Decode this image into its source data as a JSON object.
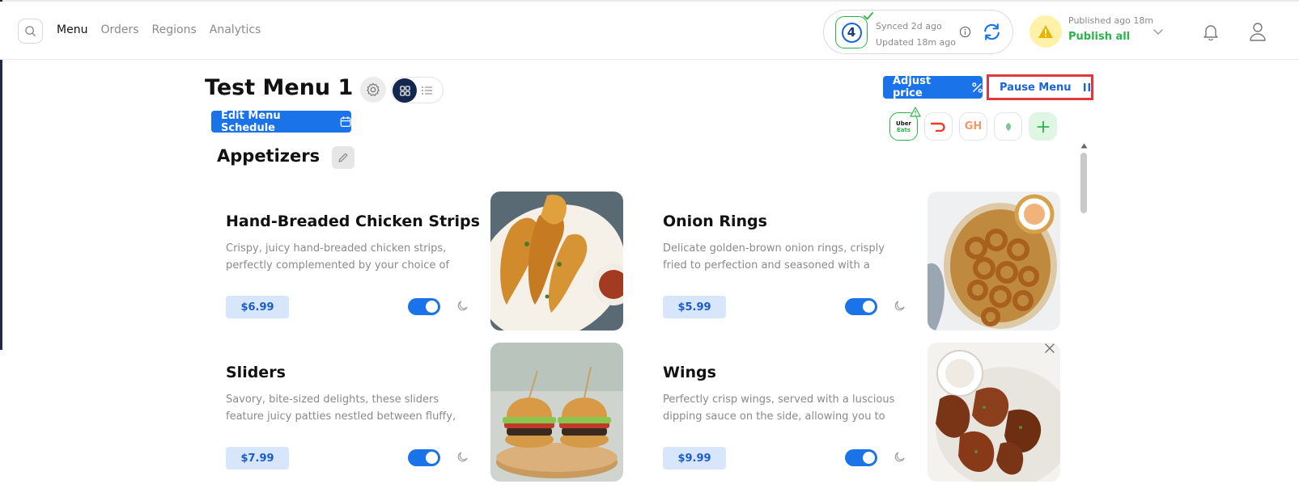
{
  "header": {
    "nav": [
      {
        "label": "Menu",
        "active": true
      },
      {
        "label": "Orders",
        "active": false
      },
      {
        "label": "Regions",
        "active": false
      },
      {
        "label": "Analytics",
        "active": false
      }
    ],
    "sync": {
      "badge_number": "4",
      "synced": "Synced 2d ago",
      "updated": "Updated 18m ago"
    },
    "publish": {
      "published": "Published ago 18m",
      "action": "Publish all"
    },
    "icons": [
      "search-icon",
      "info-icon",
      "refresh-icon",
      "warning-icon",
      "chevron-down-icon",
      "bell-icon",
      "user-icon"
    ]
  },
  "menu": {
    "title": "Test Menu 1",
    "edit_schedule_label": "Edit Menu Schedule",
    "adjust_price_label": "Adjust price",
    "pause_label": "Pause Menu",
    "platforms": [
      "Uber Eats",
      "DoorDash",
      "GH",
      "Postmates"
    ],
    "uber_logo_top": "Uber",
    "uber_logo_bottom": "Eats",
    "gh_logo": "GH"
  },
  "section": {
    "title": "Appetizers"
  },
  "items": [
    {
      "name": "Hand-Breaded Chicken Strips",
      "description": "Crispy, juicy hand-breaded chicken strips, perfectly complemented by your choice of",
      "price": "$6.99",
      "enabled": true
    },
    {
      "name": "Onion Rings",
      "description": "Delicate golden-brown onion rings, crisply fried to perfection and seasoned with a symphony of",
      "price": "$5.99",
      "enabled": true
    },
    {
      "name": "Sliders",
      "description": "Savory, bite-sized delights, these sliders feature juicy patties nestled between fluffy, buttery",
      "price": "$7.99",
      "enabled": true
    },
    {
      "name": "Wings",
      "description": "Perfectly crisp wings, served with a luscious dipping sauce on the side, allowing you to",
      "price": "$9.99",
      "enabled": true
    }
  ],
  "colors": {
    "accent": "#1a73e8",
    "success": "#2bb34a",
    "highlight": "#e0383e",
    "price_bg": "#d7e6fb"
  }
}
